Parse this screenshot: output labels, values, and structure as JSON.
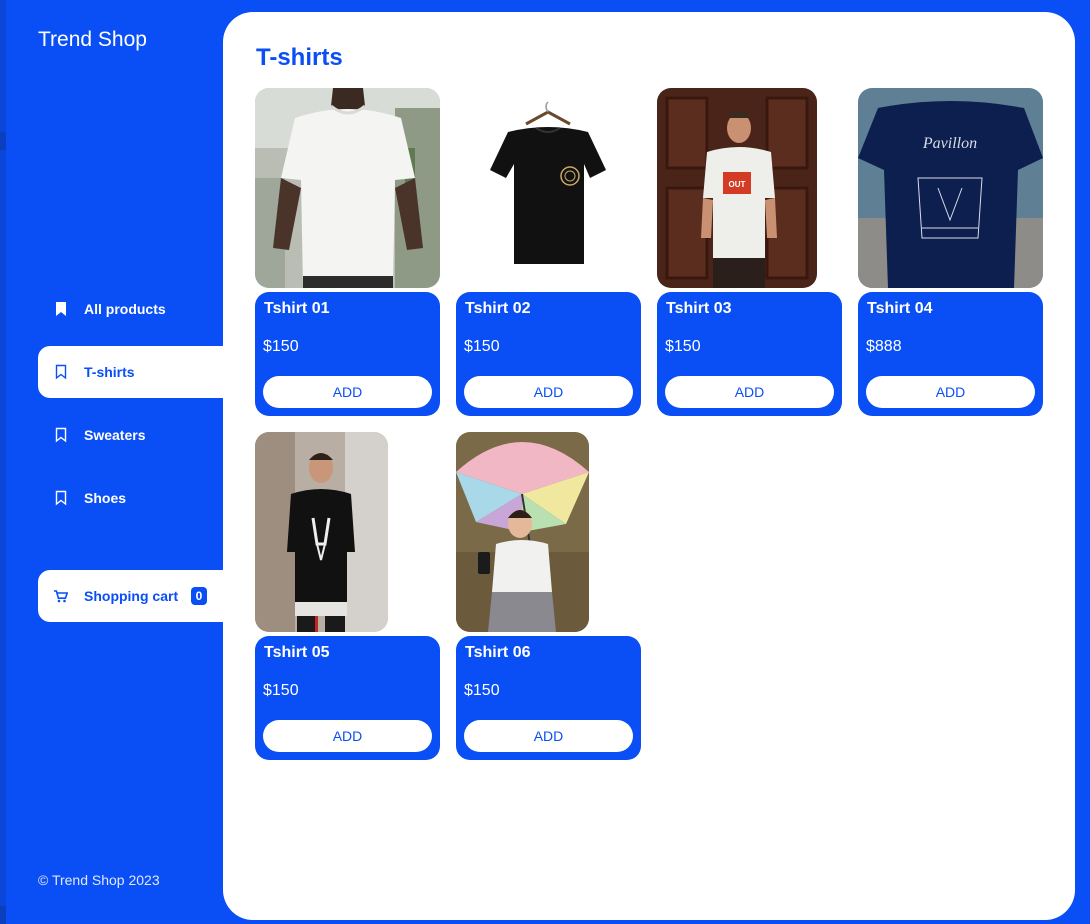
{
  "brand": "Trend Shop",
  "nav": {
    "all_products": "All products",
    "tshirts": "T-shirts",
    "sweaters": "Sweaters",
    "shoes": "Shoes",
    "cart": "Shopping cart",
    "cart_count": "0"
  },
  "footer": {
    "copyright": "© Trend Shop 2023"
  },
  "main": {
    "title": "T-shirts"
  },
  "colors": {
    "accent": "#0a4ff5",
    "surface": "#ffffff"
  },
  "products": [
    {
      "name": "Tshirt 01",
      "price": "$150",
      "add": "ADD"
    },
    {
      "name": "Tshirt 02",
      "price": "$150",
      "add": "ADD"
    },
    {
      "name": "Tshirt 03",
      "price": "$150",
      "add": "ADD"
    },
    {
      "name": "Tshirt 04",
      "price": "$888",
      "add": "ADD"
    },
    {
      "name": "Tshirt 05",
      "price": "$150",
      "add": "ADD"
    },
    {
      "name": "Tshirt 06",
      "price": "$150",
      "add": "ADD"
    }
  ]
}
